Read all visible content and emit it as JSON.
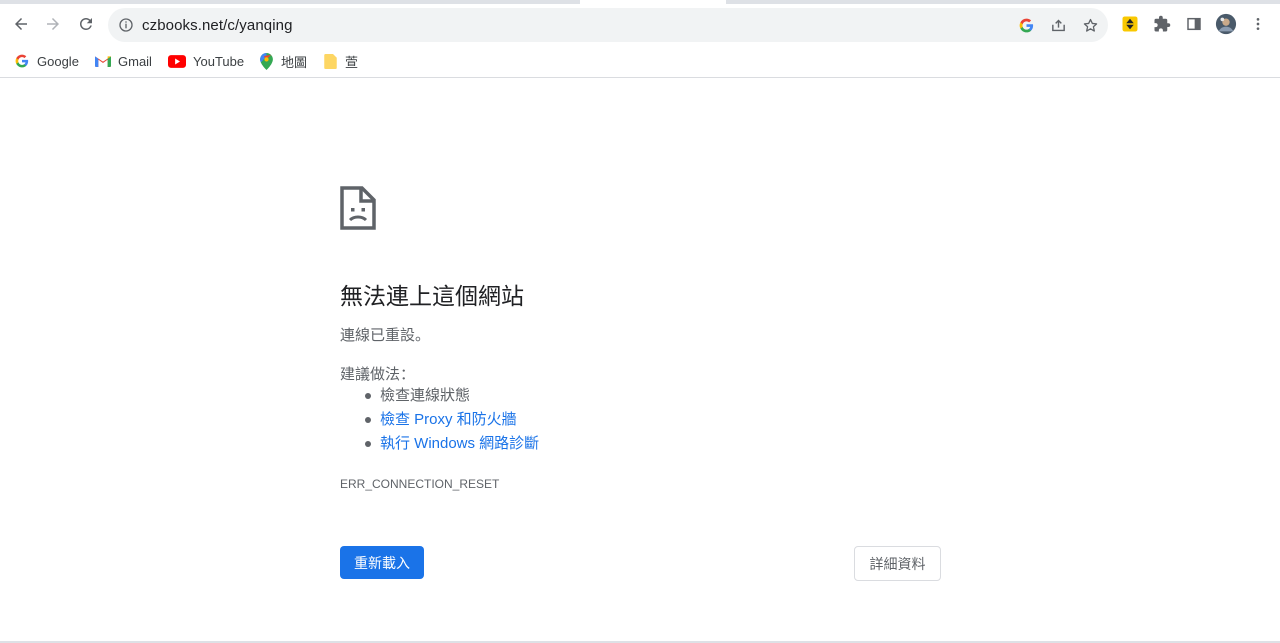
{
  "browser": {
    "url": "czbooks.net/c/yanqing",
    "colors": {
      "omnibox_bg": "#f1f3f4",
      "accent": "#1a73e8",
      "icon": "#5f6368"
    }
  },
  "toolbar": {
    "back_icon": "arrow-left-icon",
    "forward_icon": "arrow-right-icon",
    "reload_icon": "reload-icon",
    "info_icon": "info-icon",
    "google_translate_icon": "google-icon",
    "share_icon": "share-icon",
    "bookmark_icon": "star-icon",
    "extension_icon": "extension-yellow-icon",
    "extensions_icon": "puzzle-icon",
    "side_panel_icon": "side-panel-icon",
    "profile_icon": "avatar",
    "menu_icon": "kebab-menu-icon"
  },
  "bookmarks": [
    {
      "label": "Google",
      "icon": "google-g-icon"
    },
    {
      "label": "Gmail",
      "icon": "gmail-icon"
    },
    {
      "label": "YouTube",
      "icon": "youtube-icon"
    },
    {
      "label": "地圖",
      "icon": "maps-pin-icon"
    },
    {
      "label": "萱",
      "icon": "folder-icon"
    }
  ],
  "error": {
    "icon": "sad-page-icon",
    "title": "無法連上這個網站",
    "subtitle": "連線已重設。",
    "suggestions_heading": "建議做法：",
    "suggestions": [
      {
        "text": "檢查連線狀態",
        "is_link": false
      },
      {
        "text": "檢查 Proxy 和防火牆",
        "is_link": true
      },
      {
        "text": "執行 Windows 網路診斷",
        "is_link": true
      }
    ],
    "code": "ERR_CONNECTION_RESET",
    "reload_label": "重新載入",
    "details_label": "詳細資料"
  }
}
